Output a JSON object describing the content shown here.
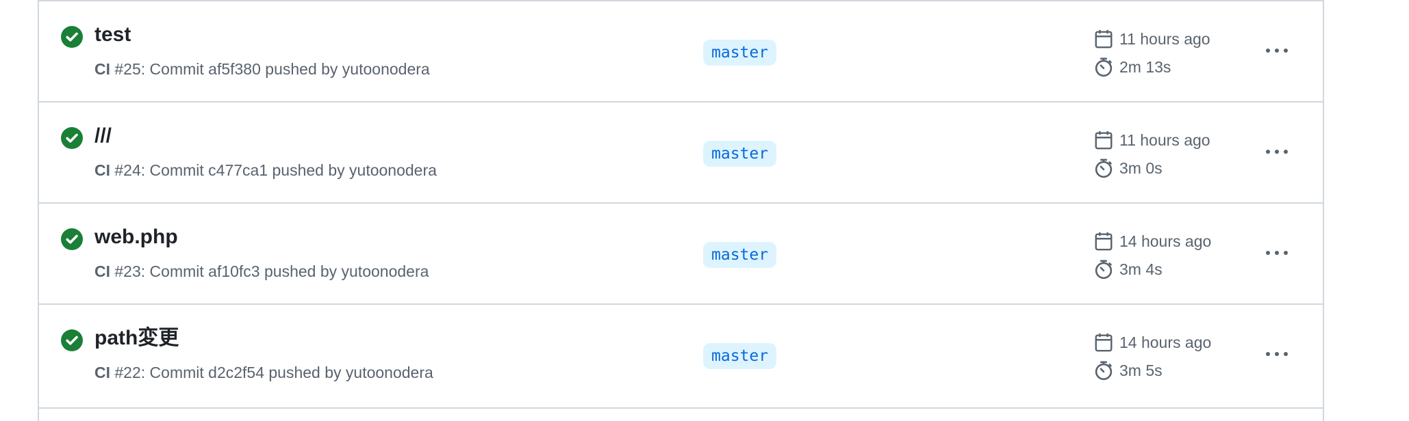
{
  "runs": [
    {
      "title": "test",
      "workflow": "CI",
      "meta": " #25: Commit af5f380 pushed by yutoonodera",
      "branch": "master",
      "time_ago": "11 hours ago",
      "duration": "2m 13s",
      "status_icon": "check-circle-fill-icon"
    },
    {
      "title": "///",
      "workflow": "CI",
      "meta": " #24: Commit c477ca1 pushed by yutoonodera",
      "branch": "master",
      "time_ago": "11 hours ago",
      "duration": "3m 0s",
      "status_icon": "check-circle-fill-icon"
    },
    {
      "title": "web.php",
      "workflow": "CI",
      "meta": " #23: Commit af10fc3 pushed by yutoonodera",
      "branch": "master",
      "time_ago": "14 hours ago",
      "duration": "3m 4s",
      "status_icon": "check-circle-fill-icon"
    },
    {
      "title": "path変更",
      "workflow": "CI",
      "meta": " #22: Commit d2c2f54 pushed by yutoonodera",
      "branch": "master",
      "time_ago": "14 hours ago",
      "duration": "3m 5s",
      "status_icon": "check-circle-fill-icon"
    }
  ],
  "icons": {
    "date": "calendar-icon",
    "duration": "stopwatch-icon",
    "menu": "kebab-horizontal-icon"
  },
  "colors": {
    "success": "#1a7f37",
    "link": "#0969da",
    "branch_bg": "#ddf4ff",
    "muted": "#59636e",
    "border": "#d0d7de"
  }
}
